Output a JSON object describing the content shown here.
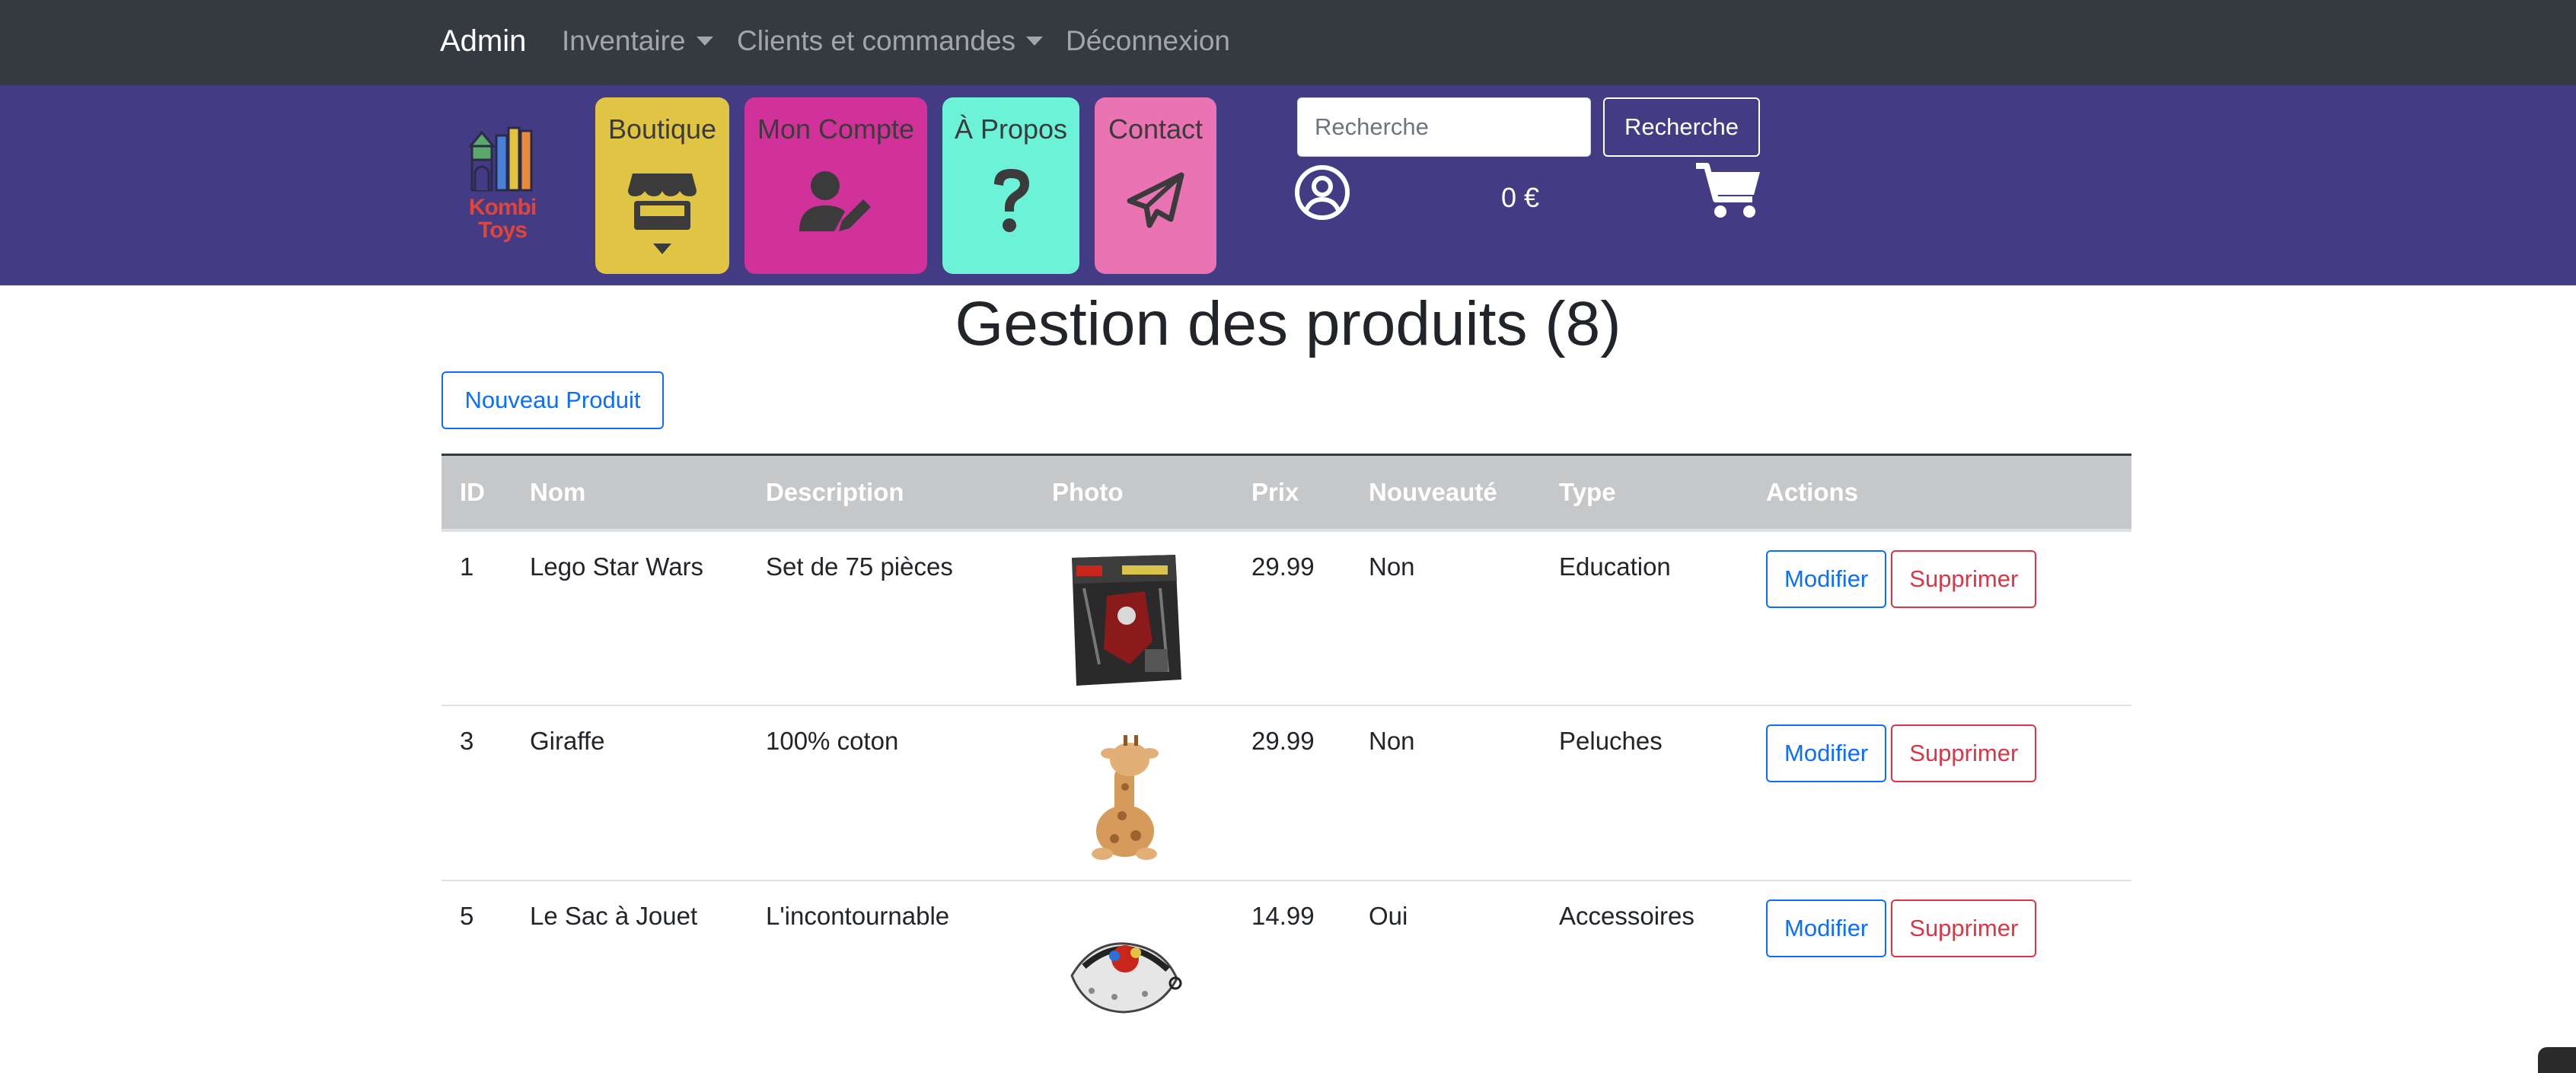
{
  "topnav": {
    "brand": "Admin",
    "inventaire": "Inventaire",
    "clients": "Clients et commandes",
    "logout": "Déconnexion"
  },
  "shop": {
    "logo_line1": "Kombi",
    "logo_line2": "Toys",
    "tiles": [
      {
        "label": "Boutique",
        "color": "#e0c443",
        "icon": "shop-icon"
      },
      {
        "label": "Mon Compte",
        "color": "#d1329a",
        "icon": "user-edit-icon"
      },
      {
        "label": "À Propos",
        "color": "#6cf2d6",
        "icon": "question-icon"
      },
      {
        "label": "Contact",
        "color": "#ea73b4",
        "icon": "paper-plane-icon"
      }
    ],
    "search_placeholder": "Recherche",
    "search_button": "Recherche",
    "cart_total": "0 €"
  },
  "main": {
    "title": "Gestion des produits (8)",
    "new_button": "Nouveau Produit",
    "columns": [
      "ID",
      "Nom",
      "Description",
      "Photo",
      "Prix",
      "Nouveauté",
      "Type",
      "Actions"
    ],
    "rows": [
      {
        "id": "1",
        "name": "Lego Star Wars",
        "description": "Set de 75 pièces",
        "photo": "lego-box",
        "price": "29.99",
        "new": "Non",
        "type": "Education"
      },
      {
        "id": "3",
        "name": "Giraffe",
        "description": "100% coton",
        "photo": "giraffe-plush",
        "price": "29.99",
        "new": "Non",
        "type": "Peluches"
      },
      {
        "id": "5",
        "name": "Le Sac à Jouet",
        "description": "L'incontournable",
        "photo": "toy-bag",
        "price": "14.99",
        "new": "Oui",
        "type": "Accessoires"
      }
    ],
    "edit_label": "Modifier",
    "delete_label": "Supprimer"
  },
  "colors": {
    "topnav_bg": "#343a40",
    "shopbar_bg": "#433c84",
    "primary": "#0d6efd",
    "danger": "#dc3545",
    "table_head": "#c6c7c8"
  }
}
